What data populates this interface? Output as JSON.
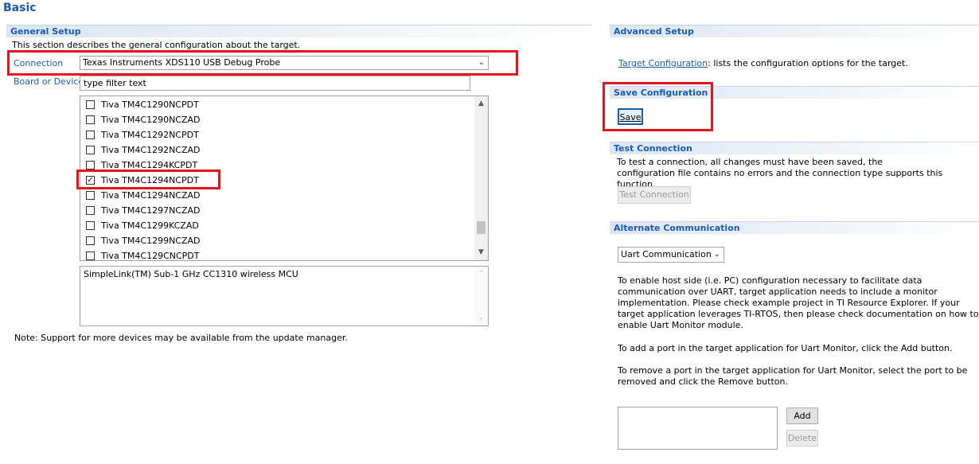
{
  "page_title": "Basic",
  "general_setup": {
    "header": "General Setup",
    "description": "This section describes the general configuration about the target.",
    "connection_label": "Connection",
    "connection_value": "Texas Instruments XDS110 USB Debug Probe",
    "board_label": "Board or Device",
    "filter_value": "type filter text",
    "devices": [
      {
        "label": "Tiva TM4C1290NCPDT",
        "checked": false
      },
      {
        "label": "Tiva TM4C1290NCZAD",
        "checked": false
      },
      {
        "label": "Tiva TM4C1292NCPDT",
        "checked": false
      },
      {
        "label": "Tiva TM4C1292NCZAD",
        "checked": false
      },
      {
        "label": "Tiva TM4C1294KCPDT",
        "checked": false
      },
      {
        "label": "Tiva TM4C1294NCPDT",
        "checked": true
      },
      {
        "label": "Tiva TM4C1294NCZAD",
        "checked": false
      },
      {
        "label": "Tiva TM4C1297NCZAD",
        "checked": false
      },
      {
        "label": "Tiva TM4C1299KCZAD",
        "checked": false
      },
      {
        "label": "Tiva TM4C1299NCZAD",
        "checked": false
      },
      {
        "label": "Tiva TM4C129CNCPDT",
        "checked": false
      }
    ],
    "device_description": "SimpleLink(TM) Sub-1 GHz CC1310 wireless MCU",
    "note": "Note: Support for more devices may be available from the update manager."
  },
  "advanced_setup": {
    "header": "Advanced Setup",
    "link_text": "Target Configuration",
    "link_suffix": ": lists the configuration options for the target."
  },
  "save_configuration": {
    "header": "Save Configuration",
    "save_button": "Save"
  },
  "test_connection": {
    "header": "Test Connection",
    "text_line1": "To test a connection, all changes must have been saved, the",
    "text_line2": "configuration file contains no errors and the connection type supports this function.",
    "button": "Test Connection"
  },
  "alternate_communication": {
    "header": "Alternate Communication",
    "select_value": "Uart Communication",
    "para1": [
      "To enable host side (i.e. PC) configuration necessary to facilitate data",
      "communication over UART, target application needs to include a monitor",
      "implementation. Please check example project in TI Resource Explorer. If your",
      "target application leverages TI-RTOS, then please check documentation on how to",
      "enable Uart Monitor module."
    ],
    "para2": "To add a port in the target application for Uart Monitor, click the Add button.",
    "para3": [
      "To remove a port in the target application for Uart Monitor, select the port to be",
      "removed and click the Remove button."
    ],
    "add_button": "Add",
    "delete_button": "Delete"
  },
  "colors": {
    "accent": "#1a5bb5",
    "highlight_box": "#e2141c"
  }
}
